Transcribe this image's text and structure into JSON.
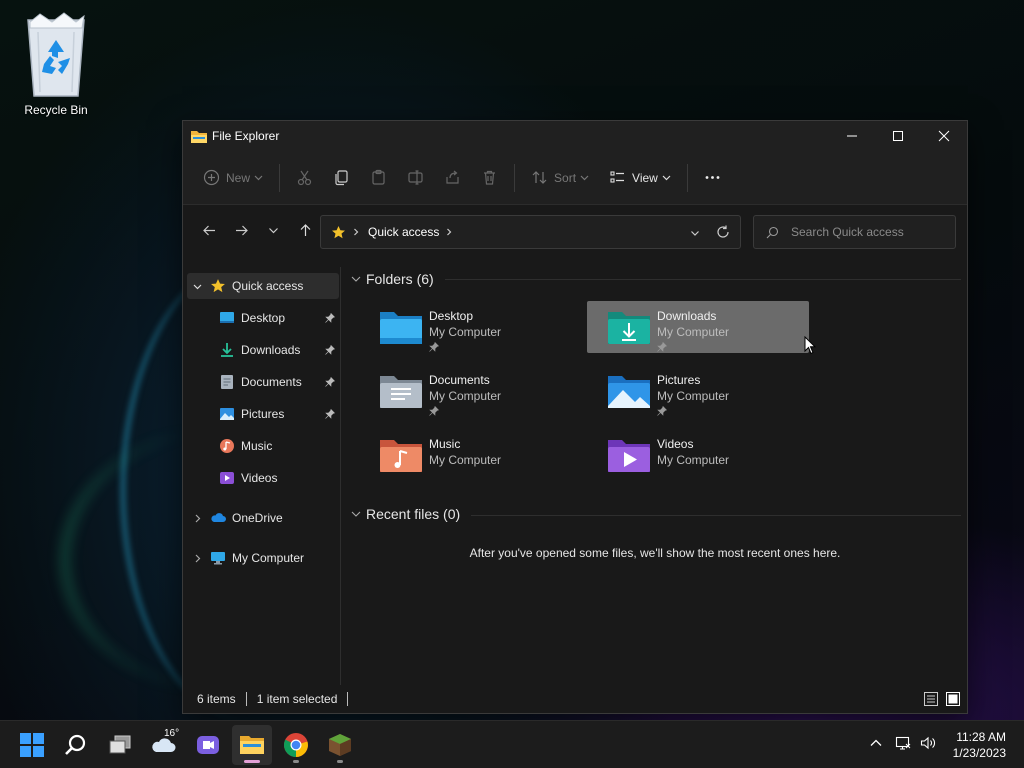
{
  "desktop": {
    "recycle_bin_label": "Recycle Bin"
  },
  "window": {
    "title": "File Explorer",
    "icons": {
      "minimize": "minimize-icon",
      "maximize": "maximize-icon",
      "close": "close-icon"
    }
  },
  "toolbar": {
    "new_label": "New",
    "sort_label": "Sort",
    "view_label": "View",
    "icons": [
      "new-icon",
      "cut-icon",
      "copy-icon",
      "paste-icon",
      "rename-icon",
      "share-icon",
      "delete-icon",
      "sort-icon",
      "view-icon",
      "more-icon"
    ]
  },
  "navigation": {
    "breadcrumb": "Quick access",
    "search_placeholder": "Search Quick access"
  },
  "sidebar": {
    "quick_access": "Quick access",
    "items": [
      {
        "label": "Desktop",
        "pinned": true
      },
      {
        "label": "Downloads",
        "pinned": true
      },
      {
        "label": "Documents",
        "pinned": true
      },
      {
        "label": "Pictures",
        "pinned": true
      },
      {
        "label": "Music",
        "pinned": false
      },
      {
        "label": "Videos",
        "pinned": false
      }
    ],
    "onedrive": "OneDrive",
    "my_computer": "My Computer"
  },
  "content": {
    "folders_header": "Folders (6)",
    "folders": [
      {
        "name": "Desktop",
        "location": "My Computer",
        "pinned": true,
        "selected": false
      },
      {
        "name": "Downloads",
        "location": "My Computer",
        "pinned": true,
        "selected": true
      },
      {
        "name": "Documents",
        "location": "My Computer",
        "pinned": true,
        "selected": false
      },
      {
        "name": "Pictures",
        "location": "My Computer",
        "pinned": true,
        "selected": false
      },
      {
        "name": "Music",
        "location": "My Computer",
        "pinned": false,
        "selected": false
      },
      {
        "name": "Videos",
        "location": "My Computer",
        "pinned": false,
        "selected": false
      }
    ],
    "recent_header": "Recent files (0)",
    "recent_empty": "After you've opened some files, we'll show the most recent ones here."
  },
  "status": {
    "item_count": "6 items",
    "selection": "1 item selected"
  },
  "taskbar": {
    "weather_temp": "16°",
    "apps": [
      "start-icon",
      "search-icon",
      "task-view-icon",
      "weather-icon",
      "chat-icon",
      "file-explorer-icon",
      "chrome-icon",
      "minecraft-icon"
    ],
    "time": "11:28 AM",
    "date": "1/23/2023"
  },
  "colors": {
    "accent": "#0078d4",
    "selection": "#6b6b6b",
    "folder_blue": "#2fa8e8",
    "folder_teal": "#1bb3a2",
    "star": "#f3c12b"
  }
}
